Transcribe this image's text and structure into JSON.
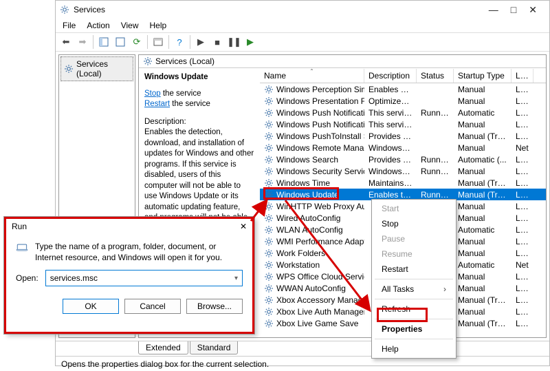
{
  "services_window": {
    "title": "Services",
    "menubar": [
      "File",
      "Action",
      "View",
      "Help"
    ],
    "tree_root": "Services (Local)",
    "main_header": "Services (Local)",
    "detail": {
      "selected_name": "Windows Update",
      "links": {
        "stop": "Stop",
        "restart": "Restart",
        "suffix": " the service"
      },
      "desc_label": "Description:",
      "desc_text": "Enables the detection, download, and installation of updates for Windows and other programs. If this service is disabled, users of this computer will not be able to use Windows Update or its automatic updating feature, and programs will not be able to use the Windows Update Agent (WUA)"
    },
    "columns": {
      "name": "Name",
      "description": "Description",
      "status": "Status",
      "startup": "Startup Type",
      "logon": "Log"
    },
    "rows": [
      {
        "name": "Windows Perception Simul...",
        "desc": "Enables spa...",
        "status": "",
        "startup": "Manual",
        "logon": "Loca"
      },
      {
        "name": "Windows Presentation Fou...",
        "desc": "Optimizes p...",
        "status": "",
        "startup": "Manual",
        "logon": "Loca"
      },
      {
        "name": "Windows Push Notificatio...",
        "desc": "This service ...",
        "status": "Running",
        "startup": "Automatic",
        "logon": "Loca"
      },
      {
        "name": "Windows Push Notificatio...",
        "desc": "This service ...",
        "status": "",
        "startup": "Manual",
        "logon": "Loca"
      },
      {
        "name": "Windows PushToInstall Serv...",
        "desc": "Provides inf...",
        "status": "",
        "startup": "Manual (Trig...",
        "logon": "Loca"
      },
      {
        "name": "Windows Remote Manag...",
        "desc": "Windows R...",
        "status": "",
        "startup": "Manual",
        "logon": "Net"
      },
      {
        "name": "Windows Search",
        "desc": "Provides co...",
        "status": "Running",
        "startup": "Automatic (...",
        "logon": "Loca"
      },
      {
        "name": "Windows Security Service",
        "desc": "Windows Se...",
        "status": "Running",
        "startup": "Manual",
        "logon": "Loca"
      },
      {
        "name": "Windows Time",
        "desc": "Maintains d...",
        "status": "",
        "startup": "Manual (Trig...",
        "logon": "Loca"
      },
      {
        "name": "Windows Update",
        "desc": "Enables the...",
        "status": "Running",
        "startup": "Manual (Trig...",
        "logon": "Loca",
        "selected": true
      },
      {
        "name": "WinHTTP Web Proxy Auto...",
        "desc": "",
        "status": "",
        "startup": "Manual",
        "logon": "Loca"
      },
      {
        "name": "Wired AutoConfig",
        "desc": "",
        "status": "",
        "startup": "Manual",
        "logon": "Loca"
      },
      {
        "name": "WLAN AutoConfig",
        "desc": "",
        "status": "",
        "startup": "Automatic",
        "logon": "Loca"
      },
      {
        "name": "WMI Performance Adapte",
        "desc": "",
        "status": "",
        "startup": "Manual",
        "logon": "Loca"
      },
      {
        "name": "Work Folders",
        "desc": "",
        "status": "",
        "startup": "Manual",
        "logon": "Loca"
      },
      {
        "name": "Workstation",
        "desc": "",
        "status": "",
        "startup": "Automatic",
        "logon": "Net"
      },
      {
        "name": "WPS Office Cloud Service",
        "desc": "",
        "status": "",
        "startup": "Manual",
        "logon": "Loca"
      },
      {
        "name": "WWAN AutoConfig",
        "desc": "",
        "status": "",
        "startup": "Manual",
        "logon": "Loca"
      },
      {
        "name": "Xbox Accessory Managem",
        "desc": "",
        "status": "",
        "startup": "Manual (Trig...",
        "logon": "Loca"
      },
      {
        "name": "Xbox Live Auth Manager",
        "desc": "",
        "status": "",
        "startup": "Manual",
        "logon": "Loca"
      },
      {
        "name": "Xbox Live Game Save",
        "desc": "",
        "status": "",
        "startup": "Manual (Trig...",
        "logon": "Loca"
      }
    ],
    "tabs": {
      "extended": "Extended",
      "standard": "Standard"
    },
    "statusbar": "Opens the properties dialog box for the current selection."
  },
  "context_menu": {
    "items": [
      {
        "label": "Start",
        "disabled": true
      },
      {
        "label": "Stop"
      },
      {
        "label": "Pause",
        "disabled": true
      },
      {
        "label": "Resume",
        "disabled": true
      },
      {
        "label": "Restart"
      },
      {
        "sep": true
      },
      {
        "label": "All Tasks",
        "submenu": true
      },
      {
        "sep": true
      },
      {
        "label": "Refresh"
      },
      {
        "sep": true
      },
      {
        "label": "Properties",
        "highlight": true
      },
      {
        "sep": true
      },
      {
        "label": "Help"
      }
    ]
  },
  "run_dialog": {
    "title": "Run",
    "instruction": "Type the name of a program, folder, document, or Internet resource, and Windows will open it for you.",
    "open_label": "Open:",
    "value": "services.msc",
    "buttons": {
      "ok": "OK",
      "cancel": "Cancel",
      "browse": "Browse..."
    }
  }
}
